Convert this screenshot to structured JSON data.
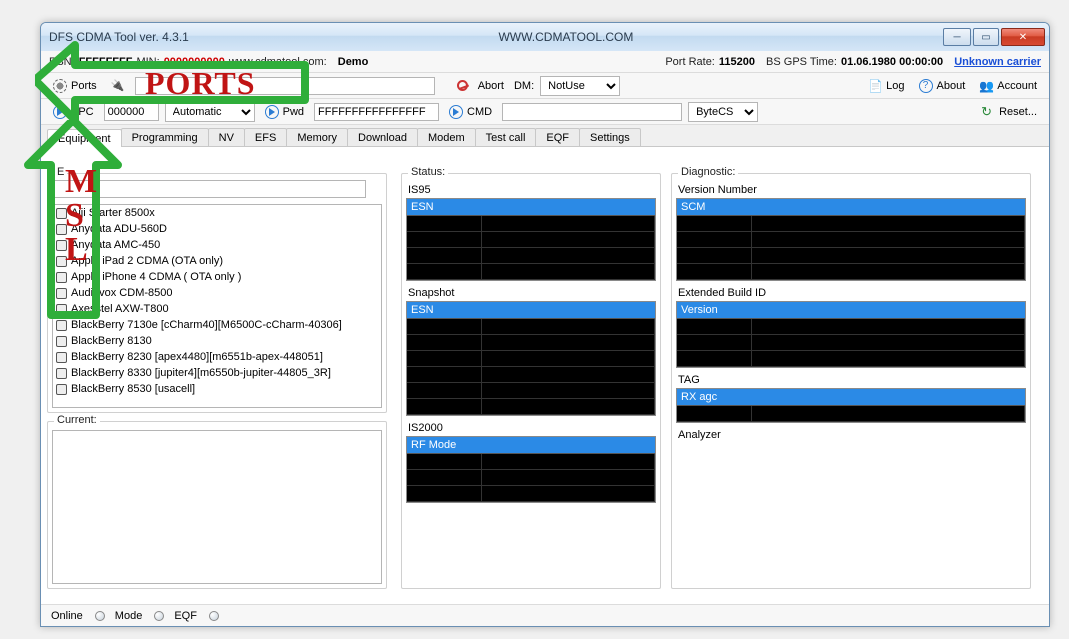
{
  "window": {
    "title": "DFS CDMA Tool ver. 4.3.1",
    "url": "WWW.CDMATOOL.COM"
  },
  "info": {
    "esn_label": "ESN:",
    "esn": "FFFFFFFF",
    "min_label": "MIN:",
    "min": "0000000000",
    "site": "www.cdmatool.com:",
    "user": "Demo",
    "port_rate_label": "Port Rate:",
    "port_rate": "115200",
    "gps_label": "BS GPS Time:",
    "gps_time": "01.06.1980 00:00:00",
    "carrier": "Unknown carrier"
  },
  "tb1": {
    "ports": "Ports",
    "abort": "Abort",
    "dm": "DM:",
    "dm_val": "NotUse",
    "log": "Log",
    "about": "About",
    "account": "Account"
  },
  "tb2": {
    "spc": "SPC",
    "spc_val": "000000",
    "auto": "Automatic",
    "pwd": "Pwd",
    "pwd_val": "FFFFFFFFFFFFFFFF",
    "cmd": "CMD",
    "bytecs": "ByteCS",
    "reset": "Reset..."
  },
  "tabs": [
    "Equipment",
    "Programming",
    "NV",
    "EFS",
    "Memory",
    "Download",
    "Modem",
    "Test call",
    "EQF",
    "Settings"
  ],
  "eq": {
    "legend": "E",
    "items": [
      "Aiji Starter 8500x",
      "Anydata ADU-560D",
      "Anydata AMC-450",
      "Apple iPad 2 CDMA (OTA only)",
      "Apple iPhone 4 CDMA ( OTA only )",
      "Audiovox CDM-8500",
      "Axesstel AXW-T800",
      "BlackBerry 7130e [cCharm40][M6500C-cCharm-40306]",
      "BlackBerry 8130",
      "BlackBerry 8230 [apex4480][m6551b-apex-448051]",
      "BlackBerry 8330 [jupiter4][m6550b-jupiter-44805_3R]",
      "BlackBerry 8530 [usacell]"
    ]
  },
  "current_legend": "Current:",
  "status": {
    "legend": "Status:",
    "is95": "IS95",
    "esn_hdr": "ESN",
    "snapshot": "Snapshot",
    "is2000": "IS2000",
    "rf_hdr": "RF Mode"
  },
  "diag": {
    "legend": "Diagnostic:",
    "version": "Version Number",
    "scm_hdr": "SCM",
    "extbuild": "Extended Build ID",
    "ver_hdr": "Version",
    "tag": "TAG",
    "rxagc_hdr": "RX agc",
    "analyzer": "Analyzer"
  },
  "statusbar": {
    "online": "Online",
    "mode": "Mode",
    "eqf": "EQF"
  },
  "anno": {
    "ports": "PORTS",
    "msl": "M\nS\nL"
  }
}
